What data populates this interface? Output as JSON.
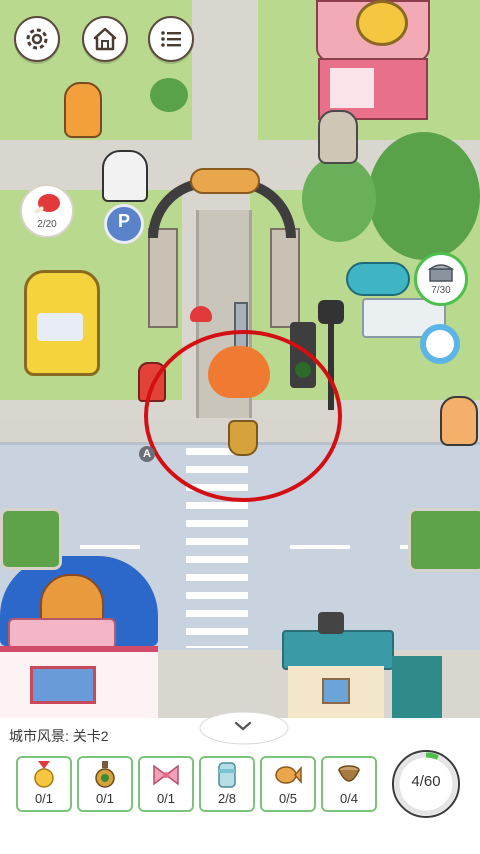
{
  "hud": {
    "settings_icon": "gear-icon",
    "home_icon": "home-icon",
    "menu_icon": "list-menu-icon"
  },
  "scene_badges": {
    "meat": {
      "icon": "meat-icon",
      "count": "2/20"
    },
    "chest": {
      "icon": "treasure-chest-icon",
      "count": "7/30"
    }
  },
  "map_marker": "A",
  "bottom_panel": {
    "level_label": "城市风景: 关卡2",
    "items": [
      {
        "icon": "medal-icon",
        "count": "0/1"
      },
      {
        "icon": "potion-icon",
        "count": "0/1"
      },
      {
        "icon": "bow-icon",
        "count": "0/1"
      },
      {
        "icon": "cup-icon",
        "count": "2/8"
      },
      {
        "icon": "taiyaki-fish-icon",
        "count": "0/5"
      },
      {
        "icon": "bowl-icon",
        "count": "0/4"
      }
    ],
    "progress": {
      "text": "4/60",
      "fraction": 0.0667
    }
  },
  "colors": {
    "grass": "#b9d98e",
    "road": "#c9d2df",
    "sidewalk": "#d8d5cf",
    "highlight_circle": "#d40f14",
    "item_border": "#7cc47c",
    "progress_fill": "#4cbf4c"
  }
}
